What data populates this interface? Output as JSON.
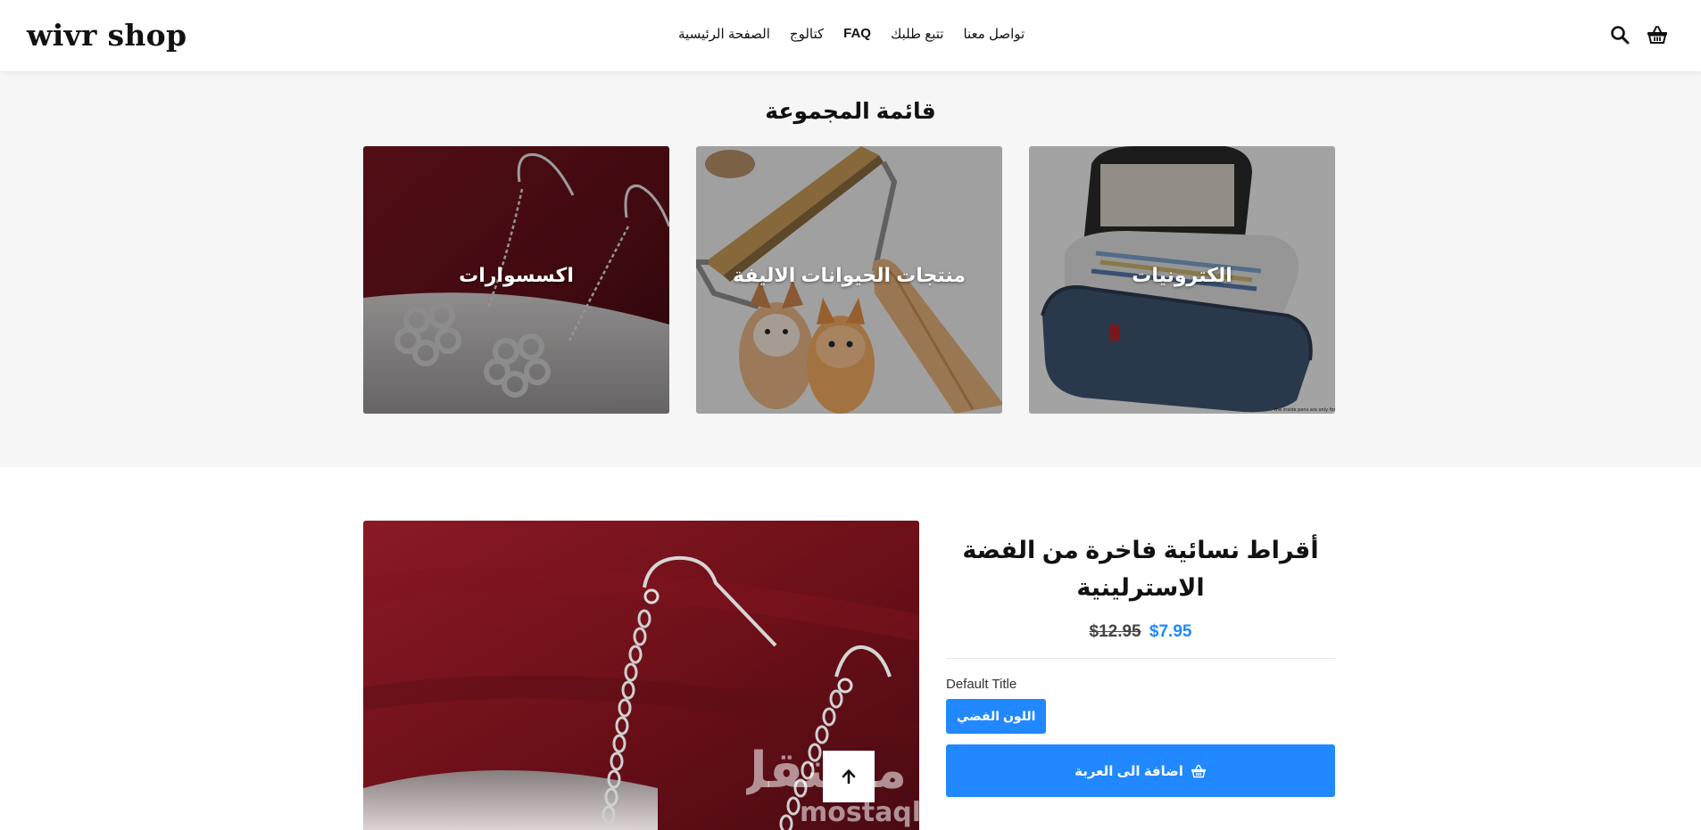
{
  "header": {
    "logo": "wivr shop",
    "nav": [
      {
        "label": "الصفحة الرئيسية",
        "name": "nav-home",
        "bold": false
      },
      {
        "label": "كتالوج",
        "name": "nav-catalog",
        "bold": false
      },
      {
        "label": "FAQ",
        "name": "nav-faq",
        "bold": true
      },
      {
        "label": "تتبع طلبك",
        "name": "nav-track-order",
        "bold": false
      },
      {
        "label": "تواصل معنا",
        "name": "nav-contact",
        "bold": false
      }
    ],
    "icons": [
      "search-icon",
      "basket-icon"
    ]
  },
  "collections": {
    "title": "قائمة المجموعة",
    "items": [
      {
        "label": "الكترونيات"
      },
      {
        "label": "منتجات الحيوانات الاليفة"
      },
      {
        "label": "اكسسوارات"
      }
    ]
  },
  "product": {
    "title": "أقراط نسائية فاخرة من الفضة الاسترلينية",
    "price_old": "$12.95",
    "price_new": "$7.95",
    "option_label": "Default Title",
    "variant": "اللون الفضي",
    "add_to_cart": "اضافة الى العربة"
  },
  "watermark": {
    "arabic": "مستقل",
    "latin": "mostaql.com"
  },
  "colors": {
    "accent": "#2188ff",
    "collections_bg": "#f6f6f6"
  }
}
